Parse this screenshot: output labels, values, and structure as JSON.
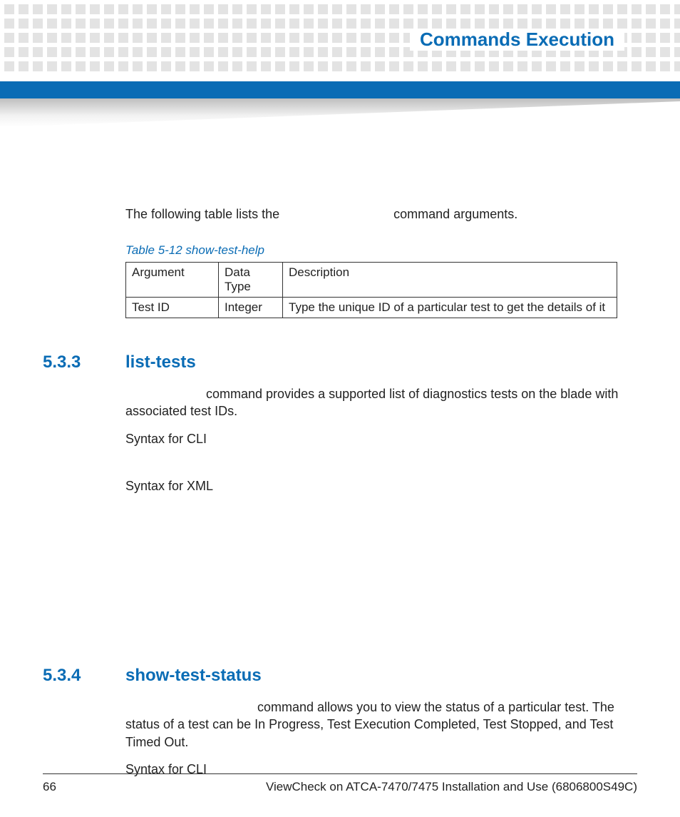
{
  "header": {
    "title": "Commands Execution"
  },
  "intro": {
    "before": "The following table lists the",
    "after": "command arguments."
  },
  "table": {
    "caption": "Table 5-12 show-test-help",
    "headers": [
      "Argument",
      "Data Type",
      "Description"
    ],
    "rows": [
      {
        "arg": "Test ID",
        "type": "Integer",
        "desc": "Type the unique ID of a particular test to get the details of it"
      }
    ]
  },
  "section1": {
    "num": "5.3.3",
    "title": "list-tests",
    "desc_after": "command provides a supported list of diagnostics tests on the blade with associated test IDs.",
    "syntax_cli_label": "Syntax for CLI",
    "syntax_xml_label": "Syntax for XML"
  },
  "section2": {
    "num": "5.3.4",
    "title": "show-test-status",
    "desc_after": "command allows you to view the status of a particular test. The status of a test can be In Progress, Test Execution Completed, Test Stopped, and Test Timed Out.",
    "syntax_cli_label": "Syntax for CLI"
  },
  "footer": {
    "page": "66",
    "doc": "ViewCheck on ATCA-7470/7475 Installation and Use (6806800S49C)"
  }
}
